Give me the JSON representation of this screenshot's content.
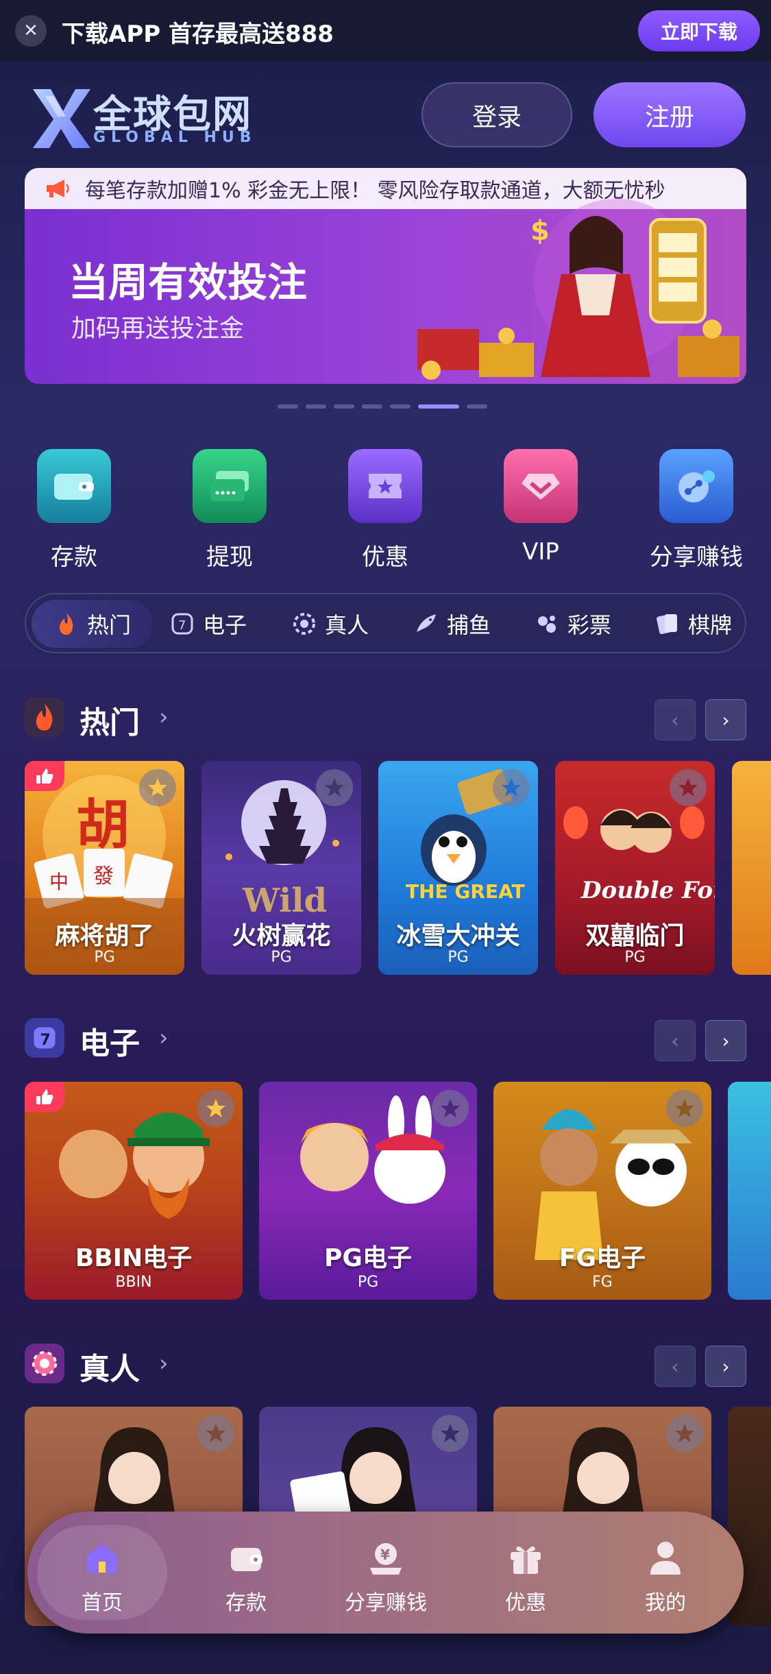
{
  "topbar": {
    "close_icon": "close-icon",
    "promo_text": "下载APP 首存最高送888",
    "download_label": "立即下载"
  },
  "header": {
    "logo_cn": "全球包网",
    "logo_en": "GLOBAL HUB",
    "login_label": "登录",
    "register_label": "注册"
  },
  "banner": {
    "marquee_text": "每笔存款加赠1% 彩金无上限！ 零风险存取款通道，大额无忧秒",
    "title": "当周有效投注",
    "subtitle": "加码再送投注金",
    "active_slide": 6,
    "slide_count": 7
  },
  "quick_actions": [
    {
      "label": "存款",
      "icon": "wallet-icon"
    },
    {
      "label": "提现",
      "icon": "cash-card-icon"
    },
    {
      "label": "优惠",
      "icon": "ticket-star-icon"
    },
    {
      "label": "VIP",
      "icon": "diamond-icon"
    },
    {
      "label": "分享赚钱",
      "icon": "share-icon"
    }
  ],
  "categories": [
    {
      "label": "热门",
      "icon": "flame-icon",
      "active": true
    },
    {
      "label": "电子",
      "icon": "slot-icon"
    },
    {
      "label": "真人",
      "icon": "chip-icon"
    },
    {
      "label": "捕鱼",
      "icon": "fish-icon"
    },
    {
      "label": "彩票",
      "icon": "lottery-icon"
    },
    {
      "label": "棋牌",
      "icon": "cards-icon"
    }
  ],
  "sections": {
    "hot": {
      "title": "热门",
      "games": [
        {
          "name": "麻将胡了",
          "provider": "PG",
          "art": "胡"
        },
        {
          "name": "火树赢花",
          "provider": "PG",
          "art": "Wild"
        },
        {
          "name": "冰雪大冲关",
          "provider": "PG",
          "art": "THE GREAT"
        },
        {
          "name": "双囍临门",
          "provider": "PG",
          "art": "Double Fortune"
        }
      ]
    },
    "electronic": {
      "title": "电子",
      "games": [
        {
          "name": "BBIN电子",
          "provider": "BBIN"
        },
        {
          "name": "PG电子",
          "provider": "PG"
        },
        {
          "name": "FG电子",
          "provider": "FG"
        }
      ]
    },
    "live": {
      "title": "真人"
    }
  },
  "bottom_nav": [
    {
      "label": "首页",
      "icon": "home-icon",
      "active": true
    },
    {
      "label": "存款",
      "icon": "wallet-icon"
    },
    {
      "label": "分享赚钱",
      "icon": "share-money-icon"
    },
    {
      "label": "优惠",
      "icon": "gift-icon"
    },
    {
      "label": "我的",
      "icon": "user-icon"
    }
  ],
  "colors": {
    "accent": "#7a4cf5",
    "background": "#23245a",
    "hot_badge": "#ff3b5c"
  }
}
